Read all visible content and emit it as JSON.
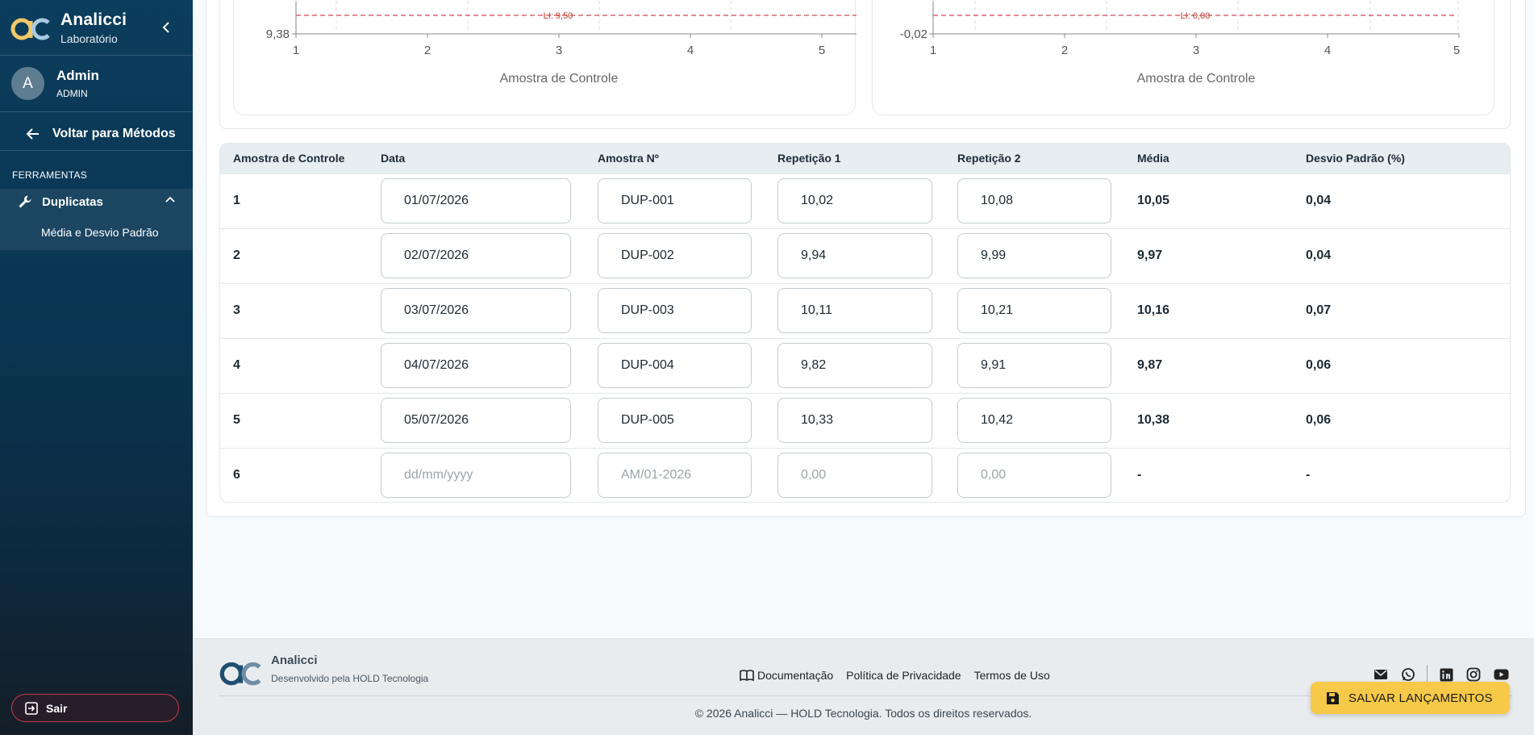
{
  "sidebar": {
    "brand_name": "Analicci",
    "brand_sub": "Laboratório",
    "user_initial": "A",
    "user_name": "Admin",
    "user_role": "ADMIN",
    "back_label": "Voltar para Métodos",
    "section_title": "FERRAMENTAS",
    "nav_group_label": "Duplicatas",
    "nav_sub_label": "Média e Desvio Padrão",
    "logout_label": "Sair"
  },
  "charts": {
    "left": {
      "y_min_label": "9,38",
      "limit_label": "LI: 9,50",
      "xlabel": "Amostra de Controle",
      "x_ticks": [
        "1",
        "2",
        "3",
        "4",
        "5"
      ]
    },
    "right": {
      "y_min_label": "-0,02",
      "limit_label": "LI: 0,00",
      "xlabel": "Amostra de Controle",
      "x_ticks": [
        "1",
        "2",
        "3",
        "4",
        "5"
      ]
    }
  },
  "table": {
    "headers": [
      "Amostra de Controle",
      "Data",
      "Amostra Nº",
      "Repetição 1",
      "Repetição 2",
      "Média",
      "Desvio Padrão (%)"
    ],
    "rows": [
      {
        "n": "1",
        "date": "01/07/2026",
        "sample": "DUP-001",
        "r1": "10,02",
        "r2": "10,08",
        "mean": "10,05",
        "sd": "0,04"
      },
      {
        "n": "2",
        "date": "02/07/2026",
        "sample": "DUP-002",
        "r1": "9,94",
        "r2": "9,99",
        "mean": "9,97",
        "sd": "0,04"
      },
      {
        "n": "3",
        "date": "03/07/2026",
        "sample": "DUP-003",
        "r1": "10,11",
        "r2": "10,21",
        "mean": "10,16",
        "sd": "0,07"
      },
      {
        "n": "4",
        "date": "04/07/2026",
        "sample": "DUP-004",
        "r1": "9,82",
        "r2": "9,91",
        "mean": "9,87",
        "sd": "0,06"
      },
      {
        "n": "5",
        "date": "05/07/2026",
        "sample": "DUP-005",
        "r1": "10,33",
        "r2": "10,42",
        "mean": "10,38",
        "sd": "0,06"
      }
    ],
    "new_row": {
      "n": "6",
      "date_ph": "dd/mm/yyyy",
      "sample_ph": "AM/01-2026",
      "r1_ph": "0,00",
      "r2_ph": "0,00",
      "mean": "-",
      "sd": "-"
    }
  },
  "footer": {
    "name": "Analicci",
    "sub": "Desenvolvido pela HOLD Tecnologia",
    "links": [
      "Documentação",
      "Política de Privacidade",
      "Termos de Uso"
    ],
    "copyright": "© 2026 Analicci — HOLD Tecnologia. Todos os direitos reservados.",
    "social_icons": [
      "mail-icon",
      "whatsapp-icon",
      "linkedin-icon",
      "instagram-icon",
      "youtube-icon"
    ]
  },
  "save_button_label": "SALVAR LANÇAMENTOS",
  "colors": {
    "sidebar": "#0b3d5c",
    "accent": "#f7c948",
    "limit_line": "#d64550",
    "logout_border": "#c23a48"
  }
}
